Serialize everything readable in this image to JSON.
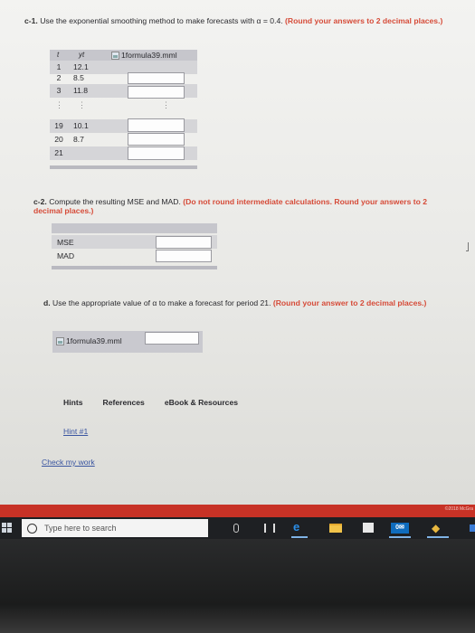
{
  "q_c1": {
    "num": "c-1.",
    "text": "Use the exponential smoothing method to make forecasts with α = 0.4.",
    "note": "(Round your answers to 2 decimal places.)",
    "table": {
      "head_t": "t",
      "head_y": "yt",
      "head_img": "1formula39.mml",
      "rows_top": [
        {
          "t": "1",
          "y": "12.1"
        },
        {
          "t": "2",
          "y": "8.5"
        },
        {
          "t": "3",
          "y": "11.8"
        }
      ],
      "dots": "⋮",
      "rows_bottom": [
        {
          "t": "19",
          "y": "10.1"
        },
        {
          "t": "20",
          "y": "8.7"
        },
        {
          "t": "21",
          "y": ""
        }
      ]
    }
  },
  "q_c2": {
    "num": "c-2.",
    "text": "Compute the resulting MSE and MAD.",
    "note": "(Do not round intermediate calculations. Round your answers to 2 decimal places.)",
    "rows": [
      "MSE",
      "MAD"
    ]
  },
  "q_d": {
    "num": "d.",
    "text": "Use the appropriate value of α to make a forecast for period 21.",
    "note": "(Round your answer to 2 decimal places.)",
    "img": "1formula39.mml"
  },
  "links": {
    "hints": "Hints",
    "references": "References",
    "ebook": "eBook & Resources"
  },
  "hint1": "Hint #1",
  "check": "Check my work",
  "footer_copy": "©2018 McGra",
  "taskbar": {
    "search_placeholder": "Type here to search",
    "mail_label": "0✉"
  },
  "colors": {
    "accent_red": "#d64b38",
    "link_blue": "#3a55a0",
    "red_bar": "#c73226"
  }
}
